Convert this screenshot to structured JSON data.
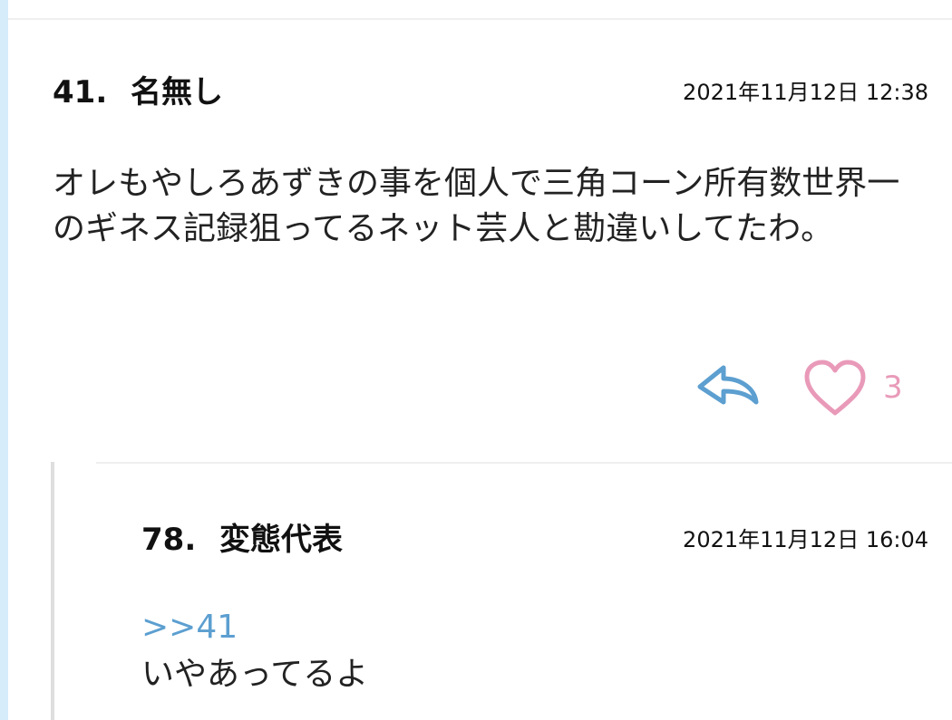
{
  "comment": {
    "number": "41.",
    "name": "名無し",
    "date": "2021年11月12日 12:38",
    "body": "オレもやしろあずきの事を個人で三角コーン所有数世界一のギネス記録狙ってるネット芸人と勘違いしてたわ。",
    "like_count": "3",
    "reply_icon": "reply-arrow-icon",
    "like_icon": "heart-icon"
  },
  "reply": {
    "number": "78.",
    "name": "変態代表",
    "date": "2021年11月12日 16:04",
    "anchor": ">>41",
    "body": "いやあってるよ"
  },
  "colors": {
    "rail": "#d6ecfb",
    "reply_icon": "#5c9fd0",
    "heart_icon": "#e99ab8",
    "anchor": "#5c9fd0"
  }
}
